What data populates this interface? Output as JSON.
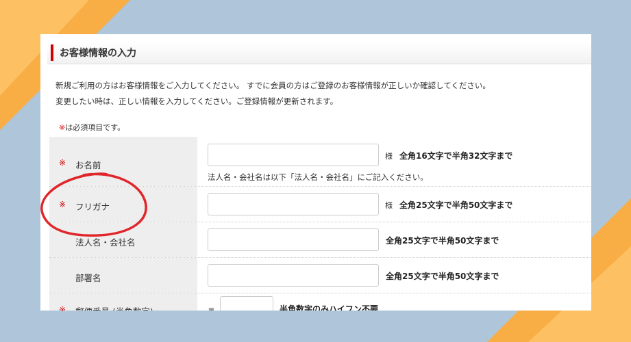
{
  "section": {
    "title": "お客様情報の入力"
  },
  "intro": {
    "line1": "新規ご利用の方はお客様情報をご入力してください。 すでに会員の方はご登録のお客様情報が正しいか確認してください。",
    "line2": "変更したい時は、正しい情報を入力してください。ご登録情報が更新されます。"
  },
  "required_note": {
    "mark": "※",
    "text": "は必須項目です。"
  },
  "form": {
    "rows": [
      {
        "required": "※",
        "label": "お名前",
        "suffix": "様",
        "limit": "全角16文字で半角32文字まで",
        "note": "法人名・会社名は以下「法人名・会社名」にご記入ください。"
      },
      {
        "required": "※",
        "label": "フリガナ",
        "suffix": "様",
        "limit": "全角25文字で半角50文字まで"
      },
      {
        "label": "法人名・会社名",
        "limit": "全角25文字で半角50文字まで"
      },
      {
        "label": "部署名",
        "limit": "全角25文字で半角50文字まで"
      },
      {
        "required": "※",
        "label": "郵便番号 (半角数字)",
        "prefix": "〒",
        "limit": "半角数字のみハイフン不要"
      }
    ]
  },
  "annotation": {
    "color": "#e0262a",
    "shape": "red-circle"
  },
  "colors": {
    "background": "#afc5d9",
    "accent": "#f8ad45",
    "required": "#d20000"
  }
}
